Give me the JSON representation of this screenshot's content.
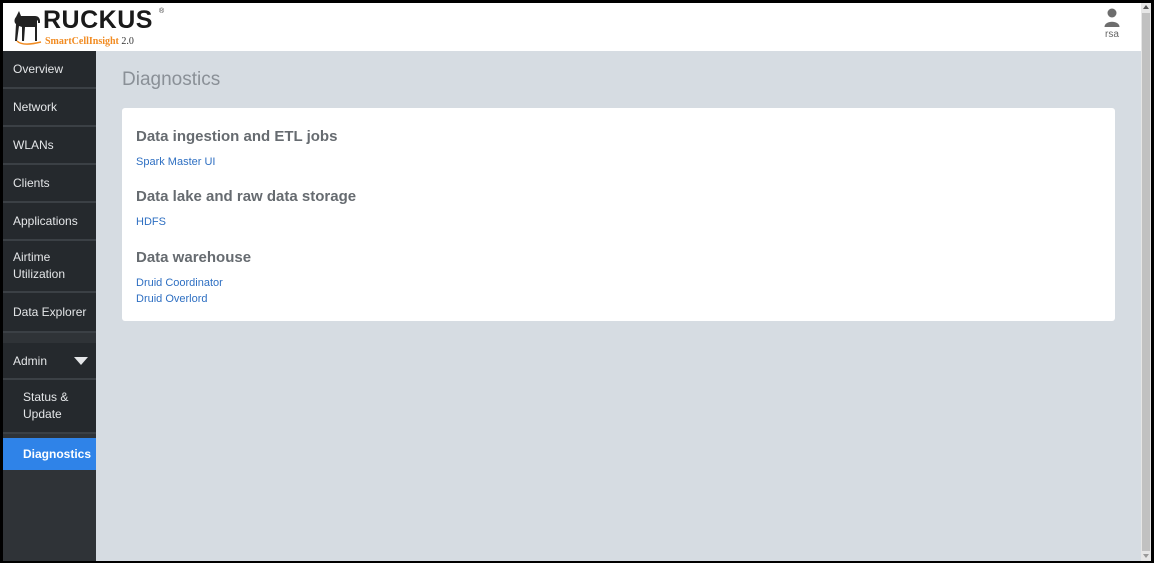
{
  "header": {
    "brand": "RUCKUS",
    "brand_reg": "®",
    "product_name": "SmartCellInsight",
    "product_version": "2.0",
    "user_label": "rsa"
  },
  "sidebar": {
    "items": [
      {
        "label": "Overview"
      },
      {
        "label": "Network"
      },
      {
        "label": "WLANs"
      },
      {
        "label": "Clients"
      },
      {
        "label": "Applications"
      },
      {
        "label": "Airtime Utilization"
      },
      {
        "label": "Data Explorer"
      },
      {
        "label": "Admin"
      },
      {
        "label": "Status & Update"
      },
      {
        "label": "Diagnostics"
      }
    ]
  },
  "main": {
    "title": "Diagnostics",
    "sections": [
      {
        "heading": "Data ingestion and ETL jobs",
        "links": [
          "Spark Master UI"
        ]
      },
      {
        "heading": "Data lake and raw data storage",
        "links": [
          "HDFS"
        ]
      },
      {
        "heading": "Data warehouse",
        "links": [
          "Druid Coordinator",
          "Druid Overlord"
        ]
      }
    ]
  },
  "colors": {
    "accent": "#2f83e8",
    "sidebar_bg": "#25292d",
    "content_bg": "#d6dce2",
    "link": "#2e6fc2",
    "brand_orange": "#f18b21"
  },
  "icons": {
    "logo": "dog-logo-icon",
    "user": "user-avatar-icon",
    "admin_toggle": "caret-down-icon"
  }
}
